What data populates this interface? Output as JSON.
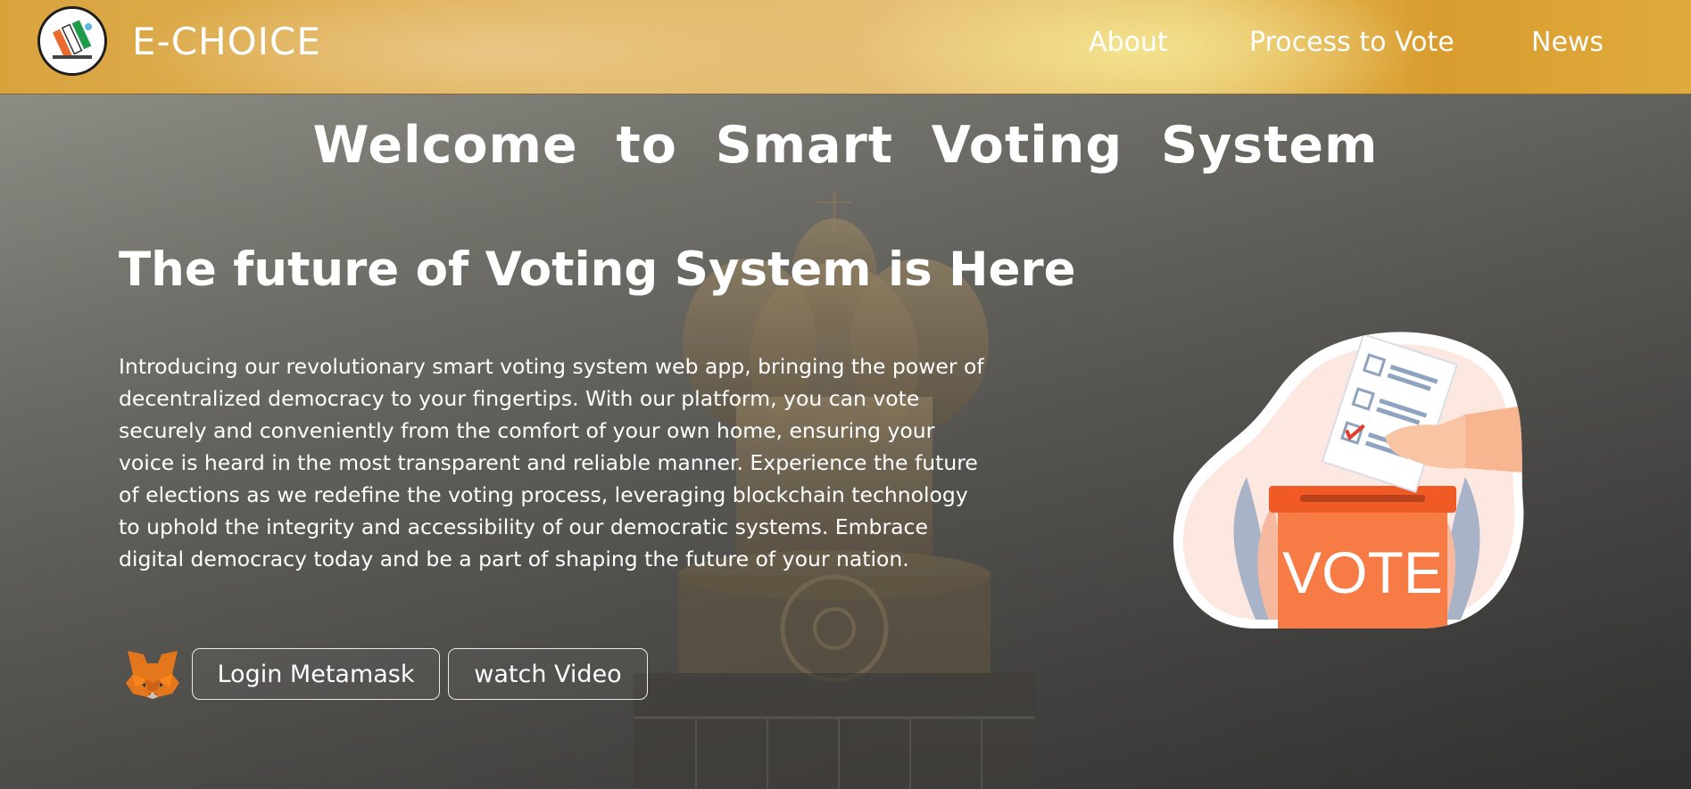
{
  "header": {
    "brand": "E-CHOICE",
    "logo_icon": "ballot-logo-icon",
    "nav": [
      {
        "label": "About"
      },
      {
        "label": "Process to Vote"
      },
      {
        "label": "News"
      }
    ]
  },
  "hero": {
    "welcome": "Welcome to Smart Voting System",
    "headline": "The future of Voting System is Here",
    "intro": "Introducing our revolutionary smart voting system web app, bringing the power of decentralized democracy to your fingertips. With our platform, you can vote securely and conveniently from the comfort of your own home, ensuring your voice is heard in the most transparent and reliable manner. Experience the future of elections as we redefine the voting process, leveraging blockchain technology to uphold the integrity and accessibility of our democratic systems. Embrace digital democracy today and be a part of shaping the future of your nation.",
    "background_icon": "ashoka-emblem-icon"
  },
  "actions": {
    "metamask_icon": "metamask-fox-icon",
    "login_label": "Login Metamask",
    "video_label": "watch Video"
  },
  "illustration": {
    "box_label": "VOTE",
    "icon": "ballot-box-icon"
  },
  "colors": {
    "header_gold": "#e0aa3c",
    "header_highlight": "#f3e28e",
    "ballot_box": "#f26b3a",
    "text": "#ffffff"
  }
}
